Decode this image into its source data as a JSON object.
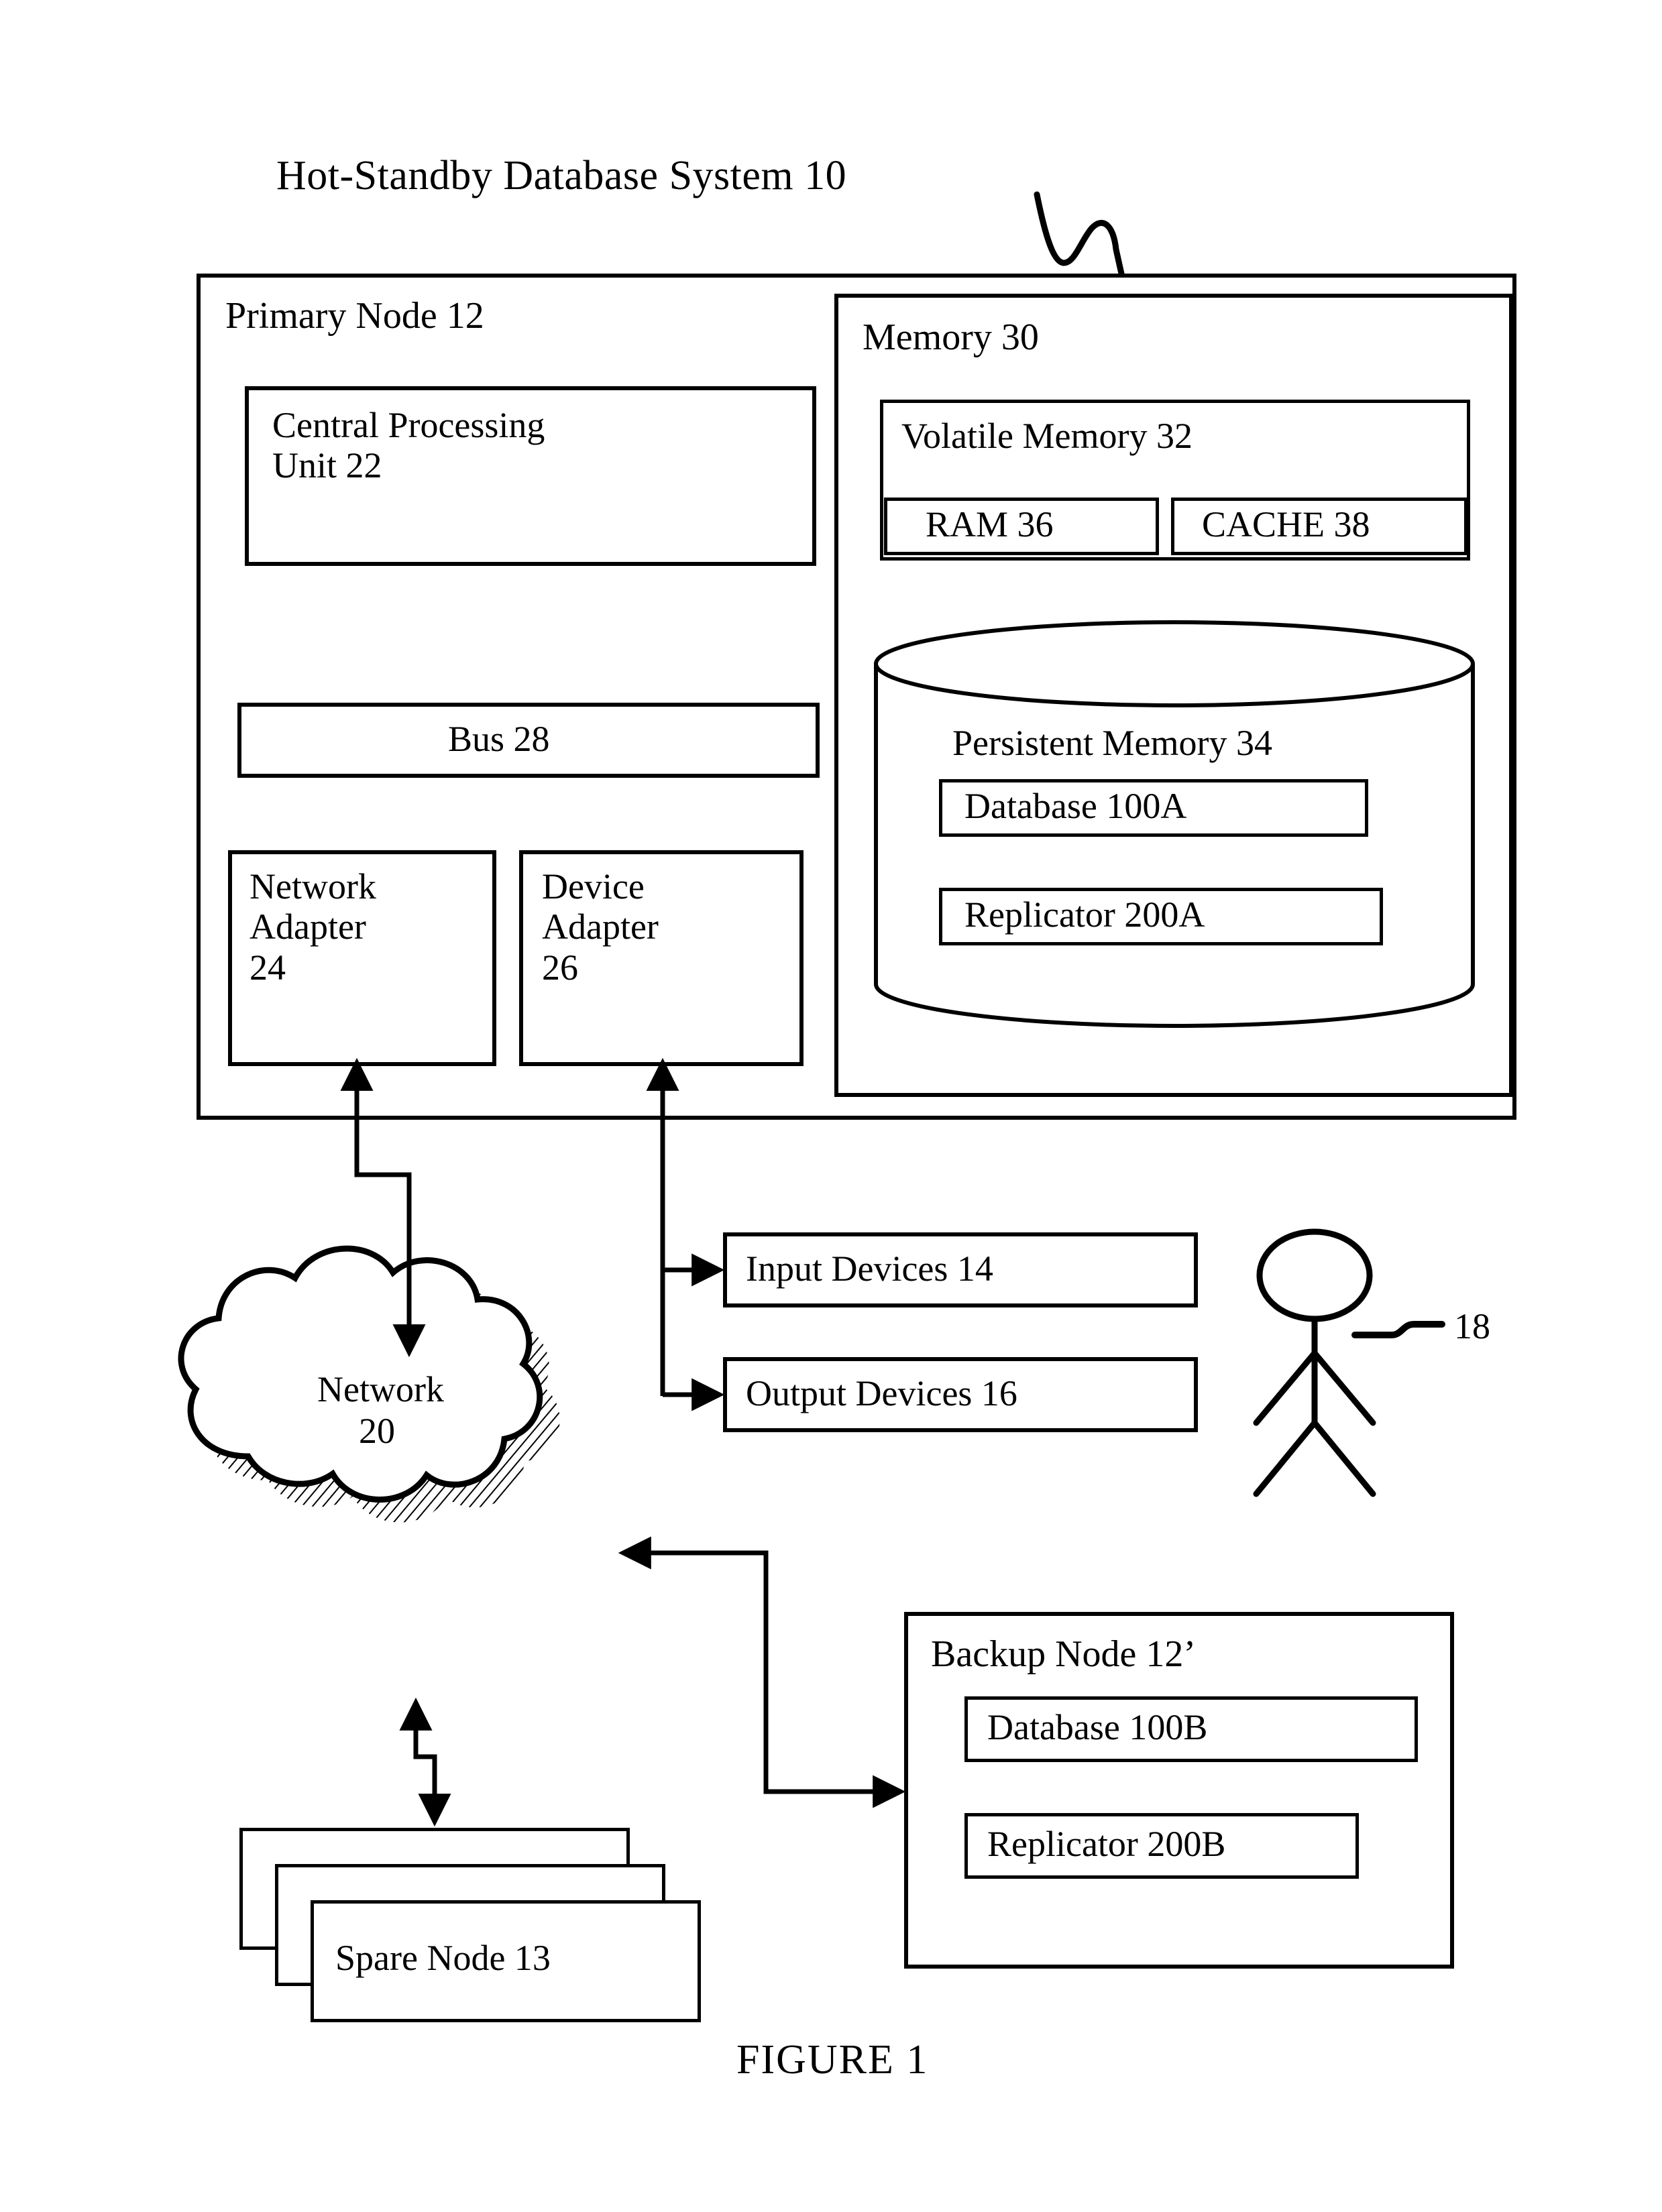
{
  "figure": {
    "caption": "FIGURE 1",
    "system_title": "Hot-Standby Database System 10",
    "system_ref": "10"
  },
  "primary_node": {
    "label": "Primary Node 12",
    "cpu": "Central Processing\nUnit 22",
    "bus": "Bus 28",
    "network_adapter": "Network\nAdapter\n24",
    "device_adapter": "Device\nAdapter\n26"
  },
  "memory": {
    "label": "Memory 30",
    "volatile": {
      "label": "Volatile Memory 32",
      "ram": "RAM 36",
      "cache": "CACHE 38"
    },
    "persistent": {
      "label": "Persistent Memory 34",
      "database": "Database 100A",
      "replicator": "Replicator 200A"
    }
  },
  "peripherals": {
    "input_devices": "Input Devices 14",
    "output_devices": "Output Devices 16",
    "user_ref": "18"
  },
  "network": {
    "label_line1": "Network",
    "label_line2": "20"
  },
  "spare_node": {
    "label": "Spare Node 13"
  },
  "backup_node": {
    "label": "Backup Node 12’",
    "database": "Database 100B",
    "replicator": "Replicator 200B"
  },
  "chart_data": {
    "type": "diagram",
    "title": "Hot-Standby Database System 10",
    "nodes": [
      {
        "id": "10",
        "label": "Hot-Standby Database System 10"
      },
      {
        "id": "12",
        "label": "Primary Node 12"
      },
      {
        "id": "22",
        "label": "Central Processing Unit 22"
      },
      {
        "id": "28",
        "label": "Bus 28"
      },
      {
        "id": "24",
        "label": "Network Adapter 24"
      },
      {
        "id": "26",
        "label": "Device Adapter 26"
      },
      {
        "id": "30",
        "label": "Memory 30"
      },
      {
        "id": "32",
        "label": "Volatile Memory 32"
      },
      {
        "id": "36",
        "label": "RAM 36"
      },
      {
        "id": "38",
        "label": "CACHE 38"
      },
      {
        "id": "34",
        "label": "Persistent Memory 34"
      },
      {
        "id": "100A",
        "label": "Database 100A"
      },
      {
        "id": "200A",
        "label": "Replicator 200A"
      },
      {
        "id": "14",
        "label": "Input Devices 14"
      },
      {
        "id": "16",
        "label": "Output Devices 16"
      },
      {
        "id": "18",
        "label": "User 18"
      },
      {
        "id": "20",
        "label": "Network 20"
      },
      {
        "id": "13",
        "label": "Spare Node 13"
      },
      {
        "id": "12'",
        "label": "Backup Node 12’"
      },
      {
        "id": "100B",
        "label": "Database 100B"
      },
      {
        "id": "200B",
        "label": "Replicator 200B"
      }
    ],
    "edges": [
      {
        "from": "24",
        "to": "20",
        "arrow": "both"
      },
      {
        "from": "26",
        "to": "14",
        "arrow": "to"
      },
      {
        "from": "26",
        "to": "16",
        "arrow": "to"
      },
      {
        "from": "20",
        "to": "13",
        "arrow": "both"
      },
      {
        "from": "20",
        "to": "12'",
        "arrow": "both"
      }
    ]
  }
}
